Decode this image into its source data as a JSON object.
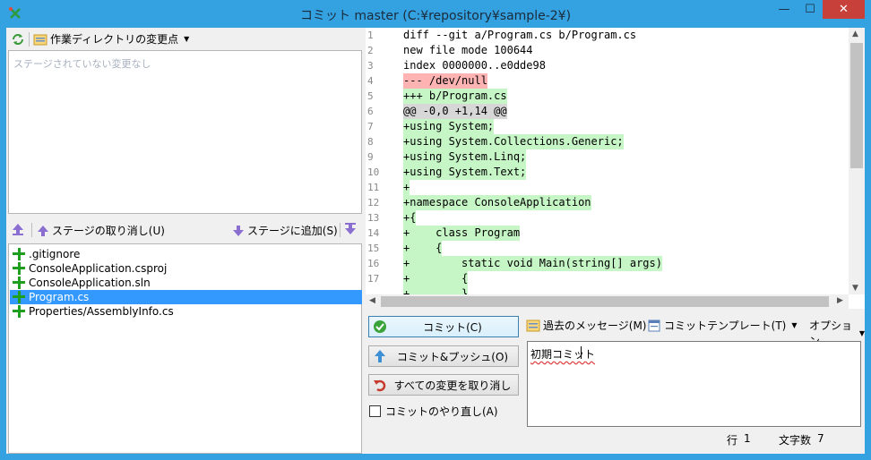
{
  "window": {
    "title": "コミット master (C:¥repository¥sample-2¥)",
    "min_glyph": "—",
    "max_glyph": "☐",
    "close_glyph": "✕"
  },
  "left": {
    "working_dir_label": "作業ディレクトリの変更点",
    "unstaged_empty": "ステージされていない変更なし",
    "unstage_label": "ステージの取り消し(U)",
    "stage_label": "ステージに追加(S)",
    "staged_files": [
      {
        "name": ".gitignore",
        "selected": false
      },
      {
        "name": "ConsoleApplication.csproj",
        "selected": false
      },
      {
        "name": "ConsoleApplication.sln",
        "selected": false
      },
      {
        "name": "Program.cs",
        "selected": true
      },
      {
        "name": "Properties/AssemblyInfo.cs",
        "selected": false
      }
    ]
  },
  "diff": {
    "line_numbers": [
      "1",
      "2",
      "3",
      "4",
      "5",
      "6",
      "7",
      "8",
      "9",
      "10",
      "11",
      "12",
      "13",
      "14",
      "15",
      "16",
      "17"
    ],
    "lines": [
      {
        "text": "diff --git a/Program.cs b/Program.cs",
        "kind": "meta"
      },
      {
        "text": "new file mode 100644",
        "kind": "meta"
      },
      {
        "text": "index 0000000..e0dde98",
        "kind": "meta"
      },
      {
        "text": "--- /dev/null",
        "kind": "del"
      },
      {
        "text": "+++ b/Program.cs",
        "kind": "add"
      },
      {
        "text": "@@ -0,0 +1,14 @@",
        "kind": "hunk"
      },
      {
        "text": "+using System;",
        "kind": "add"
      },
      {
        "text": "+using System.Collections.Generic;",
        "kind": "add"
      },
      {
        "text": "+using System.Linq;",
        "kind": "add"
      },
      {
        "text": "+using System.Text;",
        "kind": "add"
      },
      {
        "text": "+",
        "kind": "add"
      },
      {
        "text": "+namespace ConsoleApplication",
        "kind": "add"
      },
      {
        "text": "+{",
        "kind": "add"
      },
      {
        "text": "+    class Program",
        "kind": "add"
      },
      {
        "text": "+    {",
        "kind": "add"
      },
      {
        "text": "+        static void Main(string[] args)",
        "kind": "add"
      },
      {
        "text": "+        {",
        "kind": "add"
      },
      {
        "text": "+        }",
        "kind": "add"
      }
    ]
  },
  "commit": {
    "commit_button": "コミット(C)",
    "commit_push_button": "コミット&プッシュ(O)",
    "discard_button": "すべての変更を取り消し",
    "amend_label": "コミットのやり直し(A)",
    "past_messages": "過去のメッセージ(M)",
    "template": "コミットテンプレート(T)",
    "options": "オプション",
    "message": "初期コミット"
  },
  "status": {
    "line_label": "行",
    "line_value": "1",
    "chars_label": "文字数",
    "chars_value": "7"
  },
  "colors": {
    "title_bar": "#34a1e1",
    "close_red": "#c7413a",
    "selection": "#3399ff",
    "added_bg": "#c6f5c6",
    "removed_bg": "#ffb3b3"
  }
}
